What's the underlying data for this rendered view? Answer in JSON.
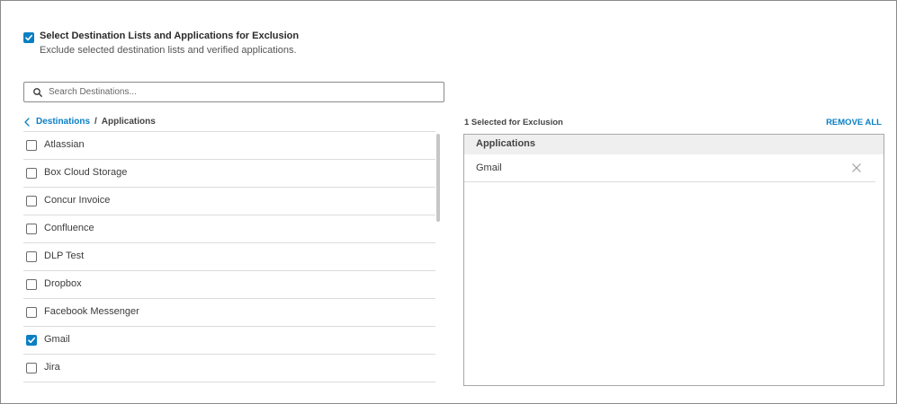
{
  "header": {
    "checked": true,
    "title": "Select Destination Lists and Applications for Exclusion",
    "subtitle": "Exclude selected destination lists and verified applications."
  },
  "search": {
    "placeholder": "Search Destinations...",
    "value": "",
    "icon": "search-icon"
  },
  "breadcrumb": {
    "back_icon": "chevron-left-icon",
    "link": "Destinations",
    "separator": "/",
    "current": "Applications"
  },
  "applications": [
    {
      "label": "Atlassian",
      "checked": false
    },
    {
      "label": "Box Cloud Storage",
      "checked": false
    },
    {
      "label": "Concur Invoice",
      "checked": false
    },
    {
      "label": "Confluence",
      "checked": false
    },
    {
      "label": "DLP Test",
      "checked": false
    },
    {
      "label": "Dropbox",
      "checked": false
    },
    {
      "label": "Facebook Messenger",
      "checked": false
    },
    {
      "label": "Gmail",
      "checked": true
    },
    {
      "label": "Jira",
      "checked": false
    }
  ],
  "selection": {
    "count_label": "1 Selected for Exclusion",
    "remove_all_label": "REMOVE ALL",
    "group_header": "Applications",
    "items": [
      {
        "label": "Gmail",
        "icon": "close-icon"
      }
    ]
  },
  "colors": {
    "accent": "#0a7fc4",
    "border": "#8a8a8a",
    "row_divider": "#dcdcdc",
    "group_header_bg": "#efefef"
  }
}
